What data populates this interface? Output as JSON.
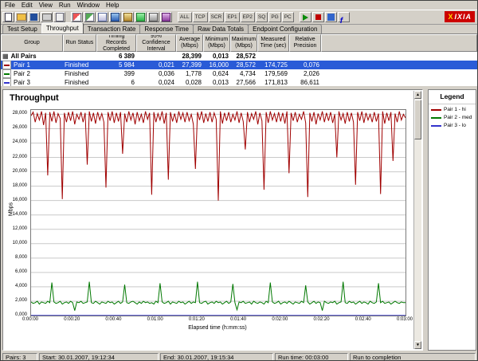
{
  "menu": {
    "items": [
      "File",
      "Edit",
      "View",
      "Run",
      "Window",
      "Help"
    ]
  },
  "toolbar": {
    "icon_groups": [
      {
        "icons": [
          "new-icon",
          "open-icon",
          "save-icon",
          "print-icon",
          "copy-icon"
        ]
      },
      {
        "icons": [
          "add-pair-icon",
          "add-group-icon",
          "edit-pair-icon",
          "throughput-chart-icon",
          "transaction-chart-icon",
          "response-chart-icon",
          "raw-data-chart-icon",
          "config-icon"
        ]
      }
    ],
    "text_buttons": [
      "ALL",
      "TCP",
      "SCR",
      "EP1",
      "EP2",
      "SQ",
      "PG",
      "PC"
    ],
    "right_icons": [
      "run-test-icon",
      "stop-test-icon",
      "schedule-icon",
      "function-icon"
    ],
    "logo_x": "X",
    "logo_text": "IXIA"
  },
  "tabs": {
    "items": [
      "Test Setup",
      "Throughput",
      "Transaction Rate",
      "Response Time",
      "Raw Data Totals",
      "Endpoint Configuration"
    ],
    "active": "Throughput"
  },
  "table": {
    "headers": [
      "Group",
      "Run Status",
      "Timing Records\nCompleted",
      "95% Confidence\nInterval",
      "Average\n(Mbps)",
      "Minimum\n(Mbps)",
      "Maximum\n(Mbps)",
      "Measured\nTime (sec)",
      "Relative\nPrecision"
    ],
    "rows": [
      {
        "icon": "all-pairs",
        "group": "All Pairs",
        "status": "",
        "bold": true,
        "selected": false,
        "cells": [
          "6 389",
          "",
          "28,399",
          "0,013",
          "28,572",
          "",
          ""
        ]
      },
      {
        "icon": "pair-1",
        "color": "#a00000",
        "group": "Pair 1",
        "status": "Finished",
        "bold": false,
        "selected": true,
        "cells": [
          "5 984",
          "0,021",
          "27,399",
          "16,000",
          "28,572",
          "174,725",
          "0,076"
        ]
      },
      {
        "icon": "pair-2",
        "color": "#007800",
        "group": "Pair 2",
        "status": "Finished",
        "bold": false,
        "selected": false,
        "cells": [
          "399",
          "0,036",
          "1,778",
          "0,624",
          "4,734",
          "179,569",
          "2,026"
        ]
      },
      {
        "icon": "pair-3",
        "color": "#3333cc",
        "group": "Pair 3",
        "status": "Finished",
        "bold": false,
        "selected": false,
        "cells": [
          "6",
          "0,024",
          "0,028",
          "0,013",
          "27,566",
          "171,813",
          "86,611"
        ]
      }
    ]
  },
  "legend": {
    "title": "Legend"
  },
  "chart_data": {
    "type": "line",
    "title": "Throughput",
    "xlabel": "Elapsed time (h:mm:ss)",
    "ylabel": "Mbps",
    "x_start_seconds": 0,
    "x_end_seconds": 180,
    "x_tick_labels": [
      "0:00:00",
      "0:00:20",
      "0:00:40",
      "0:01:00",
      "0:01:20",
      "0:01:40",
      "0:02:00",
      "0:02:20",
      "0:02:40",
      "0:03:00"
    ],
    "y_ticks": [
      0,
      2,
      4,
      6,
      8,
      10,
      12,
      14,
      16,
      18,
      20,
      22,
      24,
      26,
      28
    ],
    "y_tick_labels": [
      "0,000",
      "2,000",
      "4,000",
      "6,000",
      "8,000",
      "10,000",
      "12,000",
      "14,000",
      "16,000",
      "18,000",
      "20,000",
      "22,000",
      "24,000",
      "26,000",
      "28,000"
    ],
    "ylim": [
      0,
      28.6
    ],
    "grid": "horizontal",
    "legend_position": "right-panel",
    "series": [
      {
        "name": "Pair 1 - hi",
        "color": "#a00000",
        "values": [
          27.8,
          28.3,
          26.9,
          28.1,
          27.2,
          28.4,
          26.5,
          28.2,
          19.5,
          28.3,
          27.0,
          28.4,
          26.8,
          28.1,
          27.4,
          16.2,
          28.2,
          26.9,
          28.3,
          27.1,
          28.4,
          26.6,
          28.0,
          27.3,
          28.3,
          26.9,
          28.2,
          21.0,
          28.4,
          27.0,
          28.2,
          26.7,
          28.3,
          27.2,
          28.1,
          26.9,
          17.8,
          28.3,
          27.1,
          28.4,
          26.8,
          28.2,
          27.0,
          28.3,
          22.5,
          28.1,
          26.9,
          28.4,
          27.2,
          28.2,
          26.6,
          28.3,
          27.1,
          28.0,
          26.8,
          28.4,
          27.3,
          28.2,
          16.8,
          28.3,
          26.9,
          28.1,
          27.2,
          28.4,
          26.7,
          28.2,
          18.9,
          28.3,
          27.0,
          28.1,
          26.8,
          28.4,
          27.3,
          28.2,
          26.9,
          28.3,
          27.1,
          28.0,
          26.6,
          20.4,
          28.3,
          27.2,
          28.4,
          26.8,
          28.1,
          27.0,
          28.3,
          26.9,
          28.2,
          27.3,
          16.0,
          28.4,
          26.7,
          28.2,
          27.1,
          28.3,
          26.9,
          28.0,
          27.2,
          28.4,
          26.8,
          28.2,
          27.0,
          23.1,
          28.3,
          26.9,
          28.1,
          27.3,
          28.4,
          26.6,
          28.2,
          27.1,
          17.5,
          28.3,
          26.8,
          28.4,
          27.2,
          28.1,
          26.9,
          28.3,
          27.0,
          28.2,
          26.7,
          28.4,
          19.8,
          28.2,
          27.1,
          28.3,
          26.9,
          28.0,
          27.3,
          28.4,
          26.8,
          16.5,
          28.2,
          27.0,
          28.3,
          26.6,
          28.1,
          27.2,
          28.4,
          26.9,
          28.2,
          27.1,
          28.3,
          26.8,
          28.0,
          22.0,
          28.4,
          27.2,
          28.1,
          26.7,
          28.3,
          27.0,
          28.2,
          26.9,
          18.2,
          28.3,
          27.1,
          28.4,
          26.8,
          28.2,
          27.2,
          28.0,
          26.9,
          28.3,
          27.0,
          28.1,
          16.9,
          28.4,
          26.7,
          28.2,
          27.1,
          28.3,
          21.5,
          28.1,
          26.9,
          28.4,
          27.2,
          28.0,
          27.5
        ]
      },
      {
        "name": "Pair 2 - med",
        "color": "#007800",
        "values": [
          1.9,
          1.7,
          1.8,
          2.0,
          1.6,
          1.9,
          1.8,
          1.7,
          2.0,
          1.8,
          4.6,
          1.9,
          1.7,
          1.8,
          2.0,
          1.6,
          1.8,
          1.9,
          1.7,
          2.0,
          1.8,
          0.7,
          1.9,
          1.8,
          2.0,
          1.7,
          1.8,
          1.9,
          4.7,
          1.8,
          1.7,
          2.0,
          1.8,
          1.6,
          1.9,
          1.8,
          1.7,
          2.0,
          1.8,
          1.9,
          1.6,
          1.8,
          2.0,
          1.7,
          1.9,
          4.3,
          1.8,
          1.7,
          1.9,
          2.0,
          1.8,
          1.6,
          1.9,
          1.7,
          2.0,
          1.8,
          1.9,
          1.7,
          1.8,
          1.6,
          2.0,
          1.8,
          4.5,
          1.9,
          1.7,
          1.8,
          2.0,
          1.6,
          1.9,
          1.8,
          1.7,
          2.0,
          1.8,
          1.9,
          1.6,
          1.8,
          2.0,
          1.7,
          1.9,
          1.8,
          4.7,
          1.8,
          1.7,
          1.9,
          2.0,
          1.6,
          1.8,
          1.9,
          1.7,
          2.0,
          1.8,
          1.9,
          1.6,
          1.8,
          2.0,
          1.7,
          1.9,
          4.4,
          1.8,
          0.8,
          1.9,
          1.8,
          2.0,
          1.7,
          1.8,
          1.9,
          1.6,
          2.0,
          1.8,
          1.7,
          1.9,
          1.8,
          1.6,
          2.0,
          1.8,
          4.6,
          1.9,
          1.7,
          1.8,
          2.0,
          1.6,
          1.8,
          1.9,
          1.7,
          2.0,
          1.8,
          1.6,
          1.9,
          1.8,
          1.7,
          2.0,
          1.8,
          4.2,
          1.9,
          1.6,
          1.8,
          2.0,
          1.7,
          1.9,
          1.8,
          0.7,
          2.0,
          1.8,
          1.7,
          1.9,
          1.8,
          2.0,
          1.6,
          1.8,
          1.9,
          4.7,
          1.8,
          1.7,
          2.0,
          1.8,
          1.9,
          1.6,
          1.8,
          2.0,
          1.7,
          1.9,
          1.8,
          1.6,
          2.0,
          1.8,
          1.7,
          1.9,
          4.5,
          1.8,
          2.0,
          1.7,
          1.8,
          1.9,
          1.6,
          1.8,
          2.0,
          1.8,
          1.7,
          1.9,
          1.8,
          1.8
        ]
      },
      {
        "name": "Pair 3 - lo",
        "color": "#3333cc",
        "values": [
          0.03,
          0.03
        ]
      }
    ]
  },
  "status_bar": {
    "segments": [
      "Pairs: 3",
      "Start: 30.01.2007, 19:12:34",
      "End: 30.01.2007, 19:15:34",
      "Run time: 00:03:00",
      "Run to completion"
    ]
  }
}
